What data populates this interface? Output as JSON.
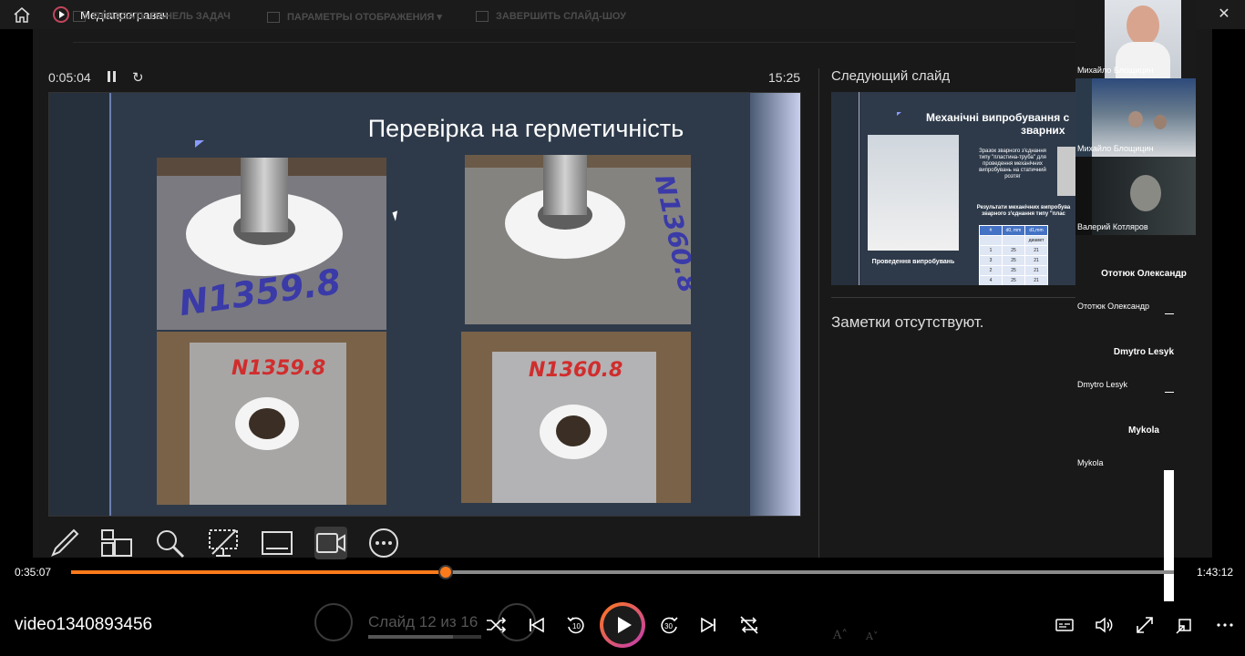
{
  "titlebar": {
    "title": "Медіапрогравач"
  },
  "presenter": {
    "top_bar": [
      "ПОКАЗАТЬ ПАНЕЛЬ ЗАДАЧ",
      "ПАРАМЕТРЫ ОТОБРАЖЕНИЯ ▾",
      "ЗАВЕРШИТЬ СЛАЙД-ШОУ"
    ],
    "timer": "0:05:04",
    "clock": "15:25",
    "slide": {
      "title": "Перевірка на герметичність",
      "labels": [
        "N1359.8",
        "N1360.8",
        "N1359.8",
        "N1360.8"
      ]
    },
    "next_slide_title": "Следующий слайд",
    "next_slide": {
      "title_line1": "Механічні випробування с",
      "title_line2": "зварних",
      "sample_text": "Зразок зварного з'єднання типу \"пластина-труба\" для проведення механічних випробувань на статичний розтяг",
      "results_text": "Результати механічних випробува зварного з'єднання типу \"плас",
      "caption": "Проведення випробувань",
      "table_header": [
        "#",
        "d0, mm",
        "d1,mm"
      ],
      "table_subheader": [
        "",
        "",
        "диамет"
      ],
      "table_rows": [
        [
          "1",
          "25",
          "21"
        ],
        [
          "3",
          "25",
          "21"
        ],
        [
          "2",
          "25",
          "21"
        ],
        [
          "4",
          "25",
          "21"
        ]
      ]
    },
    "notes": "Заметки отсутствуют."
  },
  "participants": [
    {
      "name": "Михайло Блощицин"
    },
    {
      "name": "Михайло Блощицин"
    },
    {
      "name": "Валерий Котляров"
    },
    {
      "name": "Ототюк Олександр",
      "big": "Ототюк Олександр"
    },
    {
      "name": "Dmytro Lesyk",
      "big": "Dmytro Lesyk"
    },
    {
      "name": "Mykola",
      "big": "Mykola"
    }
  ],
  "player": {
    "elapsed": "0:35:07",
    "total": "1:43:12",
    "progress": 0.34,
    "filename": "video1340893456",
    "slide_counter": "Слайд 12 из 16"
  },
  "colors": {
    "accent": "#ff7a1a",
    "accent2": "#c03ab5"
  }
}
